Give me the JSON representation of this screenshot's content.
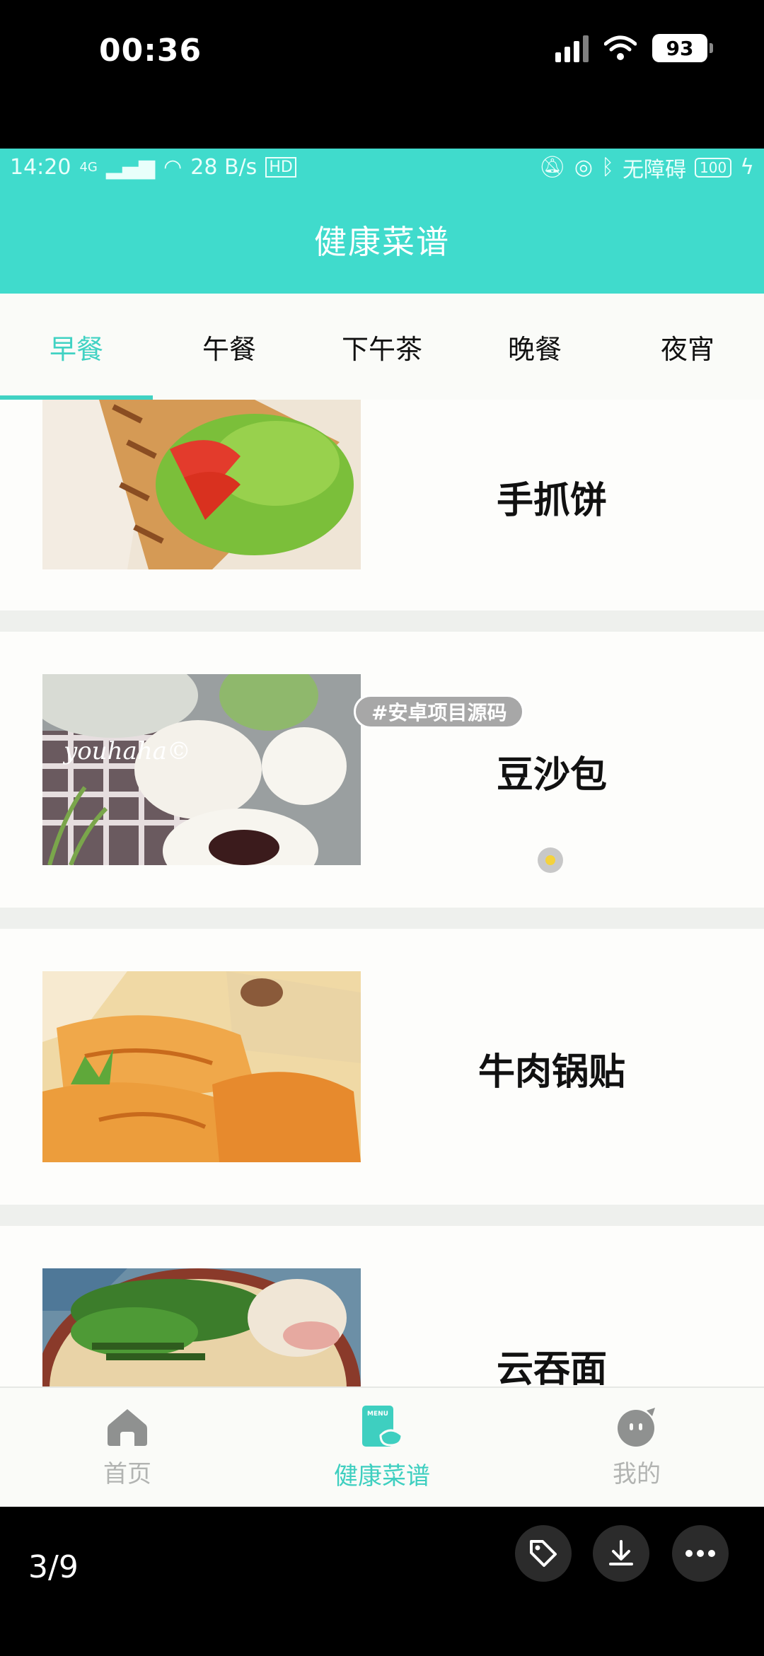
{
  "outer_status": {
    "time": "00:36",
    "battery": "93"
  },
  "inner_status": {
    "time": "14:20",
    "network": "4G",
    "speed": "28 B/s",
    "hd": "HD",
    "accessibility": "无障碍",
    "battery": "100"
  },
  "header": {
    "title": "健康菜谱"
  },
  "tabs": [
    {
      "label": "早餐",
      "active": true
    },
    {
      "label": "午餐",
      "active": false
    },
    {
      "label": "下午茶",
      "active": false
    },
    {
      "label": "晚餐",
      "active": false
    },
    {
      "label": "夜宵",
      "active": false
    }
  ],
  "recipes": [
    {
      "name": "手抓饼",
      "image": "scallion-pancake-wrap-photo"
    },
    {
      "name": "豆沙包",
      "image": "red-bean-bun-photo",
      "watermark": "youhaha©"
    },
    {
      "name": "牛肉锅贴",
      "image": "beef-potsticker-photo"
    },
    {
      "name": "云吞面",
      "image": "wonton-noodle-photo"
    }
  ],
  "overlay": {
    "tag": "#安卓项目源码"
  },
  "bottom_nav": [
    {
      "label": "首页",
      "icon": "home-icon",
      "active": false
    },
    {
      "label": "健康菜谱",
      "icon": "menu-book-icon",
      "active": true,
      "icon_text": "MENU"
    },
    {
      "label": "我的",
      "icon": "profile-icon",
      "active": false
    }
  ],
  "viewer": {
    "page_indicator": "3/9"
  },
  "colors": {
    "accent": "#40dbcc",
    "tab_active": "#40d2c3"
  }
}
